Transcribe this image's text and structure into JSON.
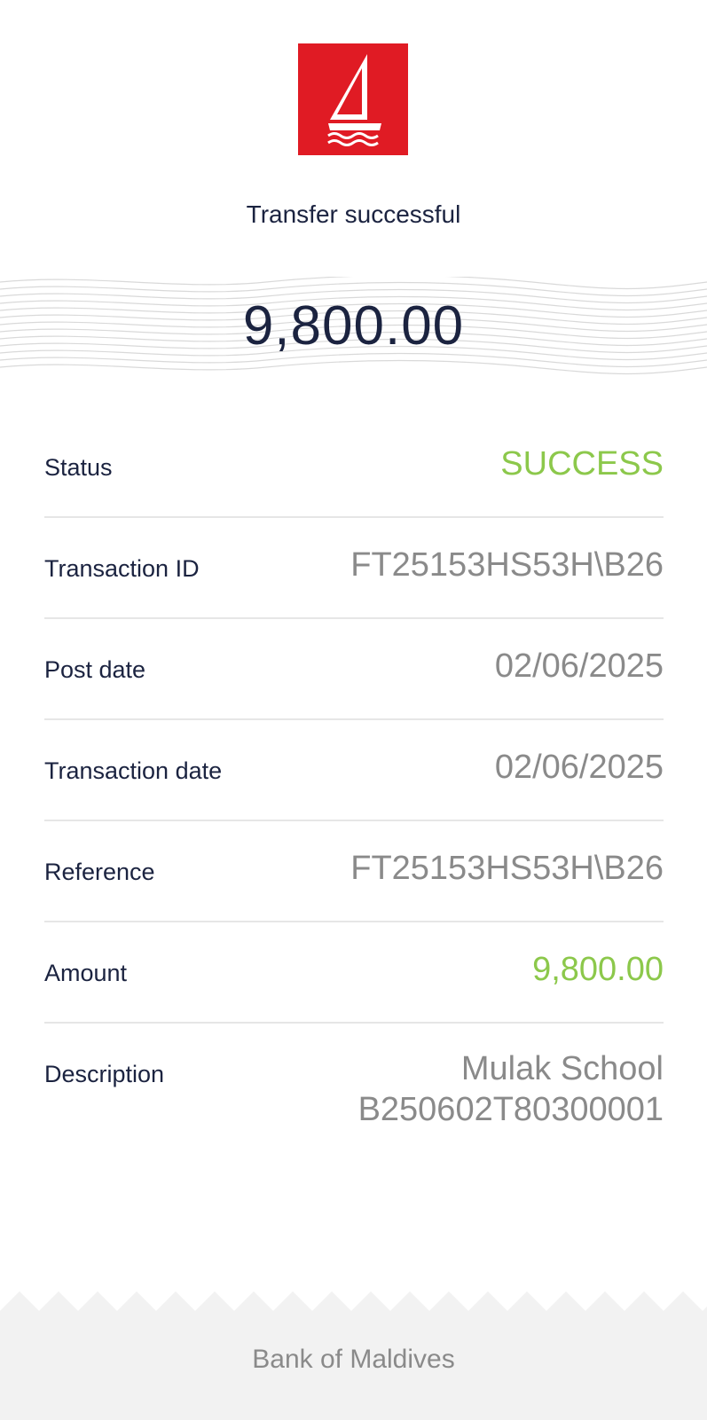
{
  "header": {
    "logo_icon": "bank-of-maldives-sailboat-logo",
    "brand_color": "#e01b24",
    "subtitle": "Transfer successful"
  },
  "amount": {
    "value": "9,800.00"
  },
  "details": [
    {
      "label": "Status",
      "value": "SUCCESS",
      "value_color": "#8cc84b"
    },
    {
      "label": "Transaction ID",
      "value": "FT25153HS53H\\B26"
    },
    {
      "label": "Post date",
      "value": "02/06/2025"
    },
    {
      "label": "Transaction date",
      "value": "02/06/2025"
    },
    {
      "label": "Reference",
      "value": "FT25153HS53H\\B26"
    },
    {
      "label": "Amount",
      "value": "9,800.00",
      "value_color": "#8cc84b"
    },
    {
      "label": "Description",
      "value_line1": "Mulak School",
      "value_line2": "B250602T80300001"
    }
  ],
  "footer": {
    "bank_name": "Bank of Maldives"
  }
}
